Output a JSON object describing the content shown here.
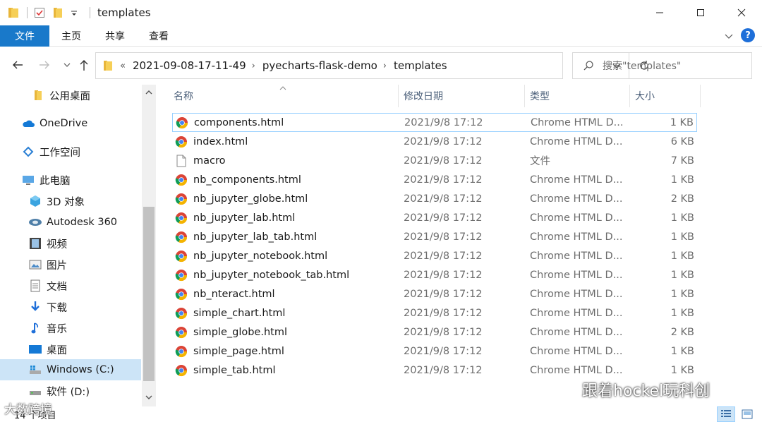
{
  "window": {
    "title": "templates",
    "controls": [
      "minimize",
      "maximize",
      "close"
    ]
  },
  "ribbon": {
    "tabs": [
      {
        "label": "文件",
        "active": true
      },
      {
        "label": "主页",
        "active": false
      },
      {
        "label": "共享",
        "active": false
      },
      {
        "label": "查看",
        "active": false
      }
    ],
    "help_label": "?"
  },
  "address": {
    "overflow": "«",
    "crumbs": [
      "2021-09-08-17-11-49",
      "pyecharts-flask-demo",
      "templates"
    ]
  },
  "search": {
    "placeholder": "搜索\"templates\""
  },
  "sidebar": {
    "items": [
      {
        "label": "公用桌面",
        "icon": "folder-icon",
        "selected": false
      },
      {
        "label": "OneDrive",
        "icon": "cloud-icon",
        "selected": false
      },
      {
        "label": "工作空间",
        "icon": "workspace-icon",
        "selected": false
      },
      {
        "label": "此电脑",
        "icon": "pc-icon",
        "selected": false
      },
      {
        "label": "3D 对象",
        "icon": "3d-objects-icon",
        "selected": false
      },
      {
        "label": "Autodesk 360",
        "icon": "autodesk-icon",
        "selected": false
      },
      {
        "label": "视频",
        "icon": "video-icon",
        "selected": false
      },
      {
        "label": "图片",
        "icon": "pictures-icon",
        "selected": false
      },
      {
        "label": "文档",
        "icon": "documents-icon",
        "selected": false
      },
      {
        "label": "下载",
        "icon": "downloads-icon",
        "selected": false
      },
      {
        "label": "音乐",
        "icon": "music-icon",
        "selected": false
      },
      {
        "label": "桌面",
        "icon": "desktop-icon",
        "selected": false
      },
      {
        "label": "Windows (C:)",
        "icon": "windows-drive-icon",
        "selected": true
      },
      {
        "label": "软件 (D:)",
        "icon": "drive-icon",
        "selected": false
      }
    ]
  },
  "columns": {
    "name": "名称",
    "date": "修改日期",
    "type": "类型",
    "size": "大小"
  },
  "files": [
    {
      "name": "components.html",
      "date": "2021/9/8 17:12",
      "type": "Chrome HTML D...",
      "size": "1 KB",
      "icon": "chrome-icon"
    },
    {
      "name": "index.html",
      "date": "2021/9/8 17:12",
      "type": "Chrome HTML D...",
      "size": "6 KB",
      "icon": "chrome-icon"
    },
    {
      "name": "macro",
      "date": "2021/9/8 17:12",
      "type": "文件",
      "size": "7 KB",
      "icon": "file-icon"
    },
    {
      "name": "nb_components.html",
      "date": "2021/9/8 17:12",
      "type": "Chrome HTML D...",
      "size": "1 KB",
      "icon": "chrome-icon"
    },
    {
      "name": "nb_jupyter_globe.html",
      "date": "2021/9/8 17:12",
      "type": "Chrome HTML D...",
      "size": "2 KB",
      "icon": "chrome-icon"
    },
    {
      "name": "nb_jupyter_lab.html",
      "date": "2021/9/8 17:12",
      "type": "Chrome HTML D...",
      "size": "1 KB",
      "icon": "chrome-icon"
    },
    {
      "name": "nb_jupyter_lab_tab.html",
      "date": "2021/9/8 17:12",
      "type": "Chrome HTML D...",
      "size": "1 KB",
      "icon": "chrome-icon"
    },
    {
      "name": "nb_jupyter_notebook.html",
      "date": "2021/9/8 17:12",
      "type": "Chrome HTML D...",
      "size": "1 KB",
      "icon": "chrome-icon"
    },
    {
      "name": "nb_jupyter_notebook_tab.html",
      "date": "2021/9/8 17:12",
      "type": "Chrome HTML D...",
      "size": "1 KB",
      "icon": "chrome-icon"
    },
    {
      "name": "nb_nteract.html",
      "date": "2021/9/8 17:12",
      "type": "Chrome HTML D...",
      "size": "1 KB",
      "icon": "chrome-icon"
    },
    {
      "name": "simple_chart.html",
      "date": "2021/9/8 17:12",
      "type": "Chrome HTML D...",
      "size": "1 KB",
      "icon": "chrome-icon"
    },
    {
      "name": "simple_globe.html",
      "date": "2021/9/8 17:12",
      "type": "Chrome HTML D...",
      "size": "2 KB",
      "icon": "chrome-icon"
    },
    {
      "name": "simple_page.html",
      "date": "2021/9/8 17:12",
      "type": "Chrome HTML D...",
      "size": "1 KB",
      "icon": "chrome-icon"
    },
    {
      "name": "simple_tab.html",
      "date": "2021/9/8 17:12",
      "type": "Chrome HTML D...",
      "size": "1 KB",
      "icon": "chrome-icon"
    }
  ],
  "status": {
    "item_count": "14 个项目"
  },
  "watermarks": {
    "right": "跟着hockel玩科创",
    "left": "大数跨境"
  },
  "colors": {
    "accent": "#1979ca",
    "selection": "#cce4f7",
    "focus_border": "#99d1ff"
  }
}
